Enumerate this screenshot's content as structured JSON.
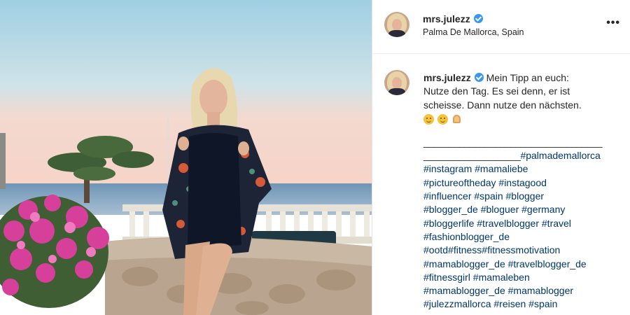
{
  "post": {
    "username": "mrs.julezz",
    "location": "Palma De Mallorca, Spain",
    "more_icon": "more-horizontal-icon",
    "caption": {
      "text_lines": [
        "Mein Tipp an euch:",
        "Nutze den Tag. Es sei denn, er ist",
        "scheisse. Dann nutze den nächsten."
      ],
      "emojis": [
        "smiling-face-icon",
        "rolling-laughing-face-icon",
        "flexed-biceps-icon"
      ],
      "dash_line_1": "___________________________________",
      "dash_line_2": "___________________",
      "first_tag": "#palmademallorca",
      "hashtag_lines": [
        "#instagram #mamaliebe",
        "#pictureoftheday #instagood",
        "#influencer #spain #blogger",
        "#blogger_de #bloguer #germany",
        "#bloggerlife #travelblogger #travel",
        "#fashionblogger_de",
        "#ootd#fitness#fitnessmotivation",
        "#mamablogger_de #travelblogger_de",
        "#fitnessgirl #mamaleben",
        "#mamablogger_de #mamablogger",
        "#julezzmallorca #reisen #spain"
      ]
    }
  },
  "colors": {
    "verified": "#3897f0",
    "hashtag": "#00376b",
    "text": "#262626"
  }
}
